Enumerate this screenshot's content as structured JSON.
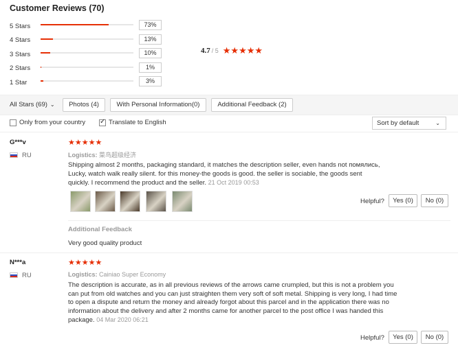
{
  "header": {
    "title": "Customer Reviews (70)"
  },
  "distribution": [
    {
      "label": "5 Stars",
      "pct": "73%",
      "fill": 0.73
    },
    {
      "label": "4 Stars",
      "pct": "13%",
      "fill": 0.13
    },
    {
      "label": "3 Stars",
      "pct": "10%",
      "fill": 0.1
    },
    {
      "label": "2 Stars",
      "pct": "1%",
      "fill": 0.01
    },
    {
      "label": "1 Star",
      "pct": "3%",
      "fill": 0.03
    }
  ],
  "overall": {
    "score": "4.7",
    "max": "/ 5",
    "stars": "★★★★★"
  },
  "filters": {
    "all_stars": "All Stars (69)",
    "photos": "Photos (4)",
    "personal": "With Personal Information(0)",
    "additional": "Additional Feedback (2)"
  },
  "options": {
    "only_country": "Only from your country",
    "translate": "Translate to English",
    "sort": "Sort by default"
  },
  "reviews": [
    {
      "name": "G***v",
      "country": "RU",
      "stars": "★★★★★",
      "logistics_label": "Logistics:",
      "logistics": "菜鸟超级经济",
      "text": "Shipping almost 2 months, packaging standard, it matches the description seller, even hands not помялись, Lucky, watch walk really silent. for this money-the goods is good. the seller is sociable, the goods sent quickly. I recommend the product and the seller.",
      "date": "21 Oct 2019 00:53",
      "thumb_colors": [
        "#8a9a6a",
        "#6b5a48",
        "#4a3a2a",
        "#5a5248",
        "#7a8a70"
      ],
      "helpful": "Helpful?",
      "yes": "Yes (0)",
      "no": "No (0)",
      "additional_title": "Additional Feedback",
      "additional_text": "Very good quality product"
    },
    {
      "name": "N***a",
      "country": "RU",
      "stars": "★★★★★",
      "logistics_label": "Logistics:",
      "logistics": "Cainiao Super Economy",
      "text": "The description is accurate, as in all previous reviews of the arrows came crumpled, but this is not a problem you can put from old watches and you can just straighten them very soft of soft metal. Shipping is very long, I had time to open a dispute and return the money and already forgot about this parcel and in the application there was no information about the delivery and after 2 months came for another parcel to the post office I was handed this package.",
      "date": "04 Mar 2020 06:21",
      "helpful": "Helpful?",
      "yes": "Yes (0)",
      "no": "No (0)"
    }
  ],
  "colors": {
    "accent": "#e62e04"
  }
}
